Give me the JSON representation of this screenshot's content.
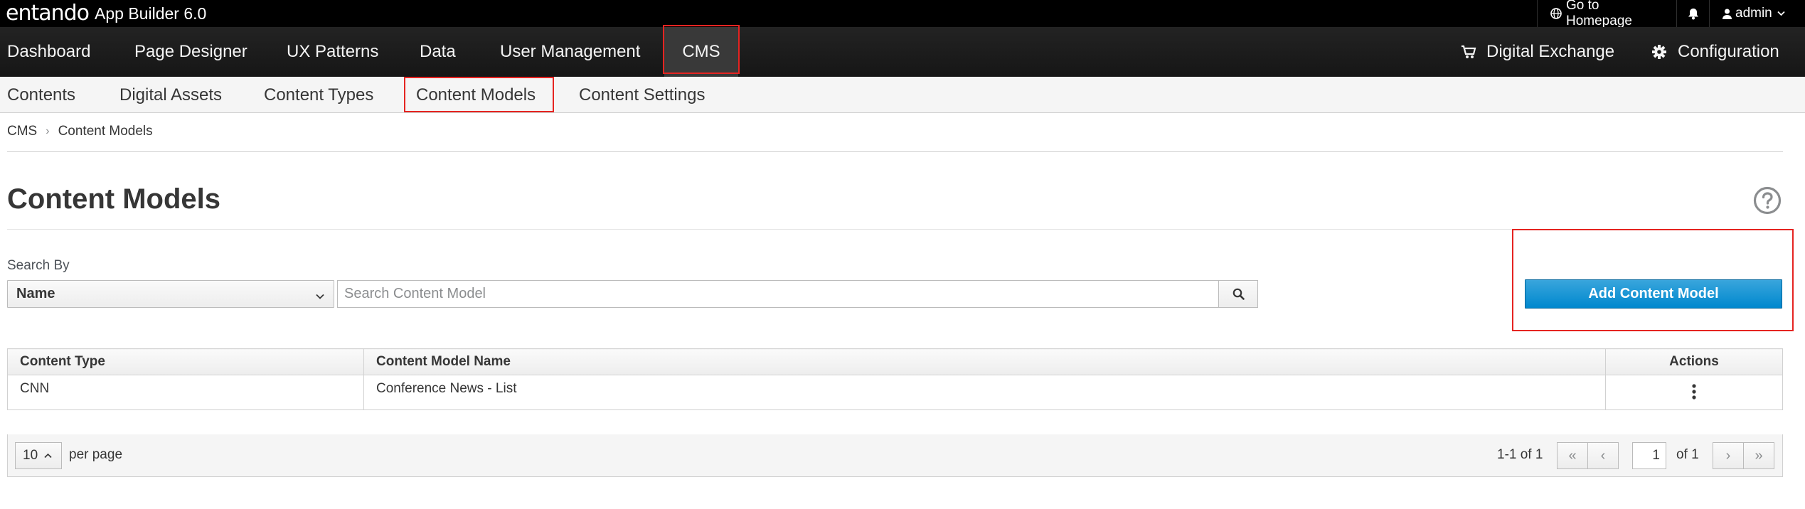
{
  "brand": {
    "logo_text": "entando",
    "app_name": "App Builder 6.0"
  },
  "topbar": {
    "go_home_label": "Go to Homepage",
    "go_home_icon": "globe-icon",
    "notifications_icon": "bell-icon",
    "user_label": "admin",
    "user_icon": "user-icon"
  },
  "mainnav": {
    "items": [
      {
        "label": "Dashboard"
      },
      {
        "label": "Page Designer"
      },
      {
        "label": "UX Patterns"
      },
      {
        "label": "Data"
      },
      {
        "label": "User Management"
      },
      {
        "label": "CMS",
        "active": true
      }
    ],
    "right": [
      {
        "label": "Digital Exchange",
        "icon": "cart-icon"
      },
      {
        "label": "Configuration",
        "icon": "gear-icon"
      }
    ]
  },
  "subnav": {
    "items": [
      {
        "label": "Contents"
      },
      {
        "label": "Digital Assets"
      },
      {
        "label": "Content Types"
      },
      {
        "label": "Content Models",
        "active": true
      },
      {
        "label": "Content Settings"
      }
    ]
  },
  "breadcrumb": {
    "root": "CMS",
    "current": "Content Models"
  },
  "page": {
    "title": "Content Models"
  },
  "search": {
    "label": "Search By",
    "select_value": "Name",
    "placeholder": "Search Content Model"
  },
  "actions": {
    "add_label": "Add Content Model"
  },
  "table": {
    "headers": [
      "Content Type",
      "Content Model Name",
      "Actions"
    ],
    "rows": [
      {
        "content_type": "CNN",
        "model_name": "Conference News - List"
      }
    ]
  },
  "pagination": {
    "per_page_value": "10",
    "per_page_label": "per page",
    "range": "1-1 of 1",
    "current_page": "1",
    "of_label": "of 1"
  },
  "colors": {
    "highlight_border": "#e52421",
    "primary_button": "#0088ce",
    "topbar_bg": "#000000",
    "mainnav_bg": "#1b1b1b"
  }
}
